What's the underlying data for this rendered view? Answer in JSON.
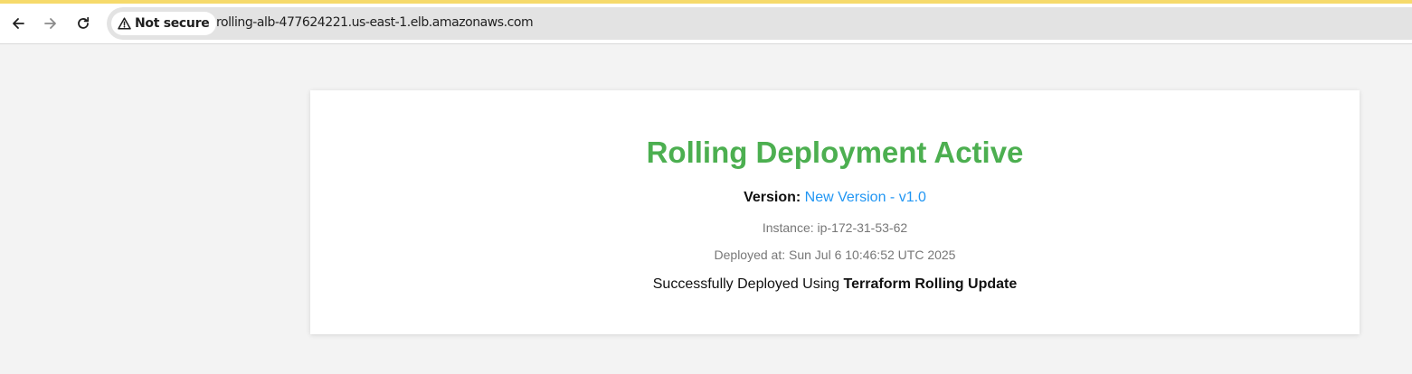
{
  "browser": {
    "accent_color": "#f6da6b",
    "nav": {
      "back_icon": "arrow-left-icon",
      "forward_icon": "arrow-right-icon",
      "reload_icon": "reload-icon"
    },
    "security_chip": {
      "icon": "warning-triangle-icon",
      "label": "Not secure"
    },
    "url": "rolling-alb-477624221.us-east-1.elb.amazonaws.com"
  },
  "page": {
    "title": "Rolling Deployment Active",
    "title_color": "#4caf50",
    "version_label": "Version:",
    "version_value": "New Version - v1.0",
    "version_color": "#2196f3",
    "instance": "Instance: ip-172-31-53-62",
    "deployed_at": "Deployed at: Sun Jul 6 10:46:52 UTC 2025",
    "success_prefix": "Successfully Deployed Using",
    "success_tool": "Terraform Rolling Update"
  }
}
